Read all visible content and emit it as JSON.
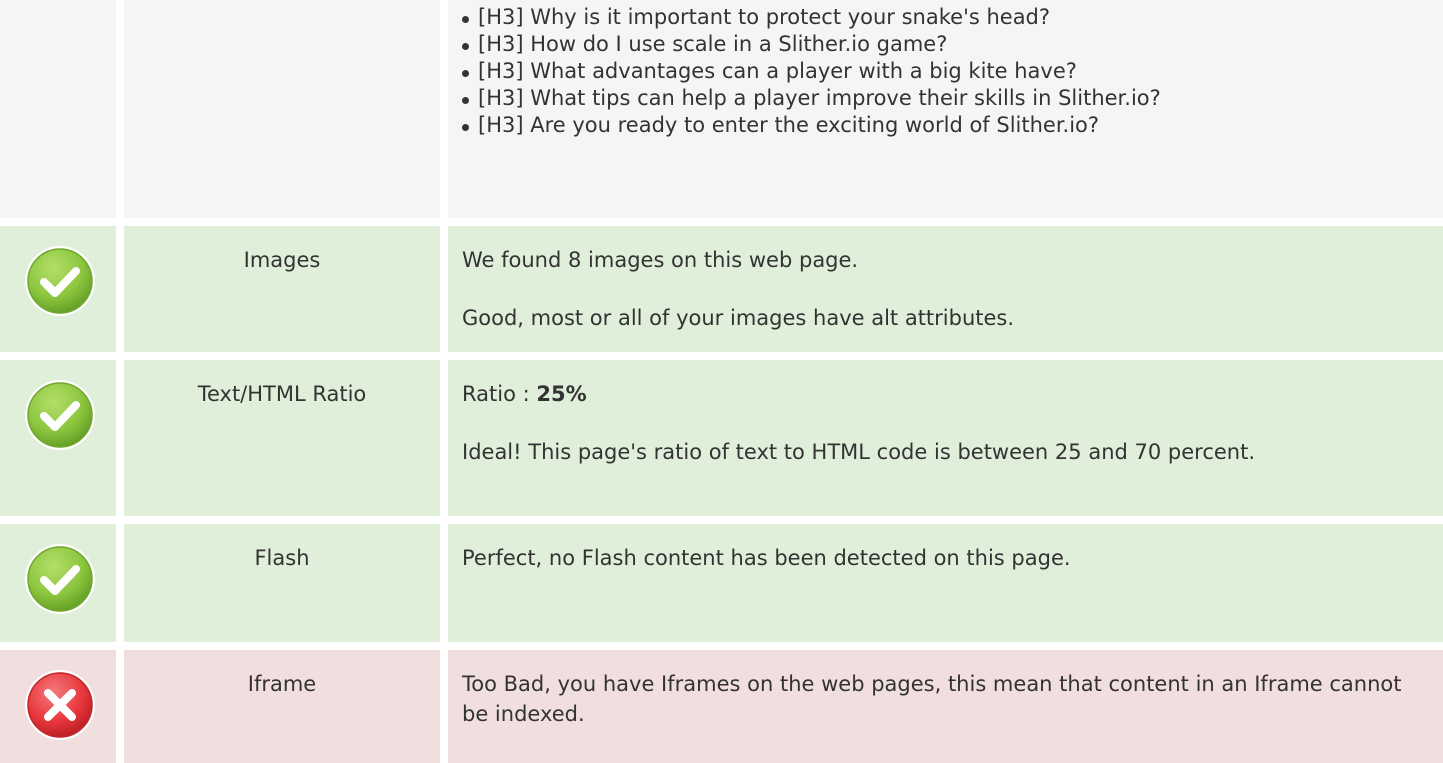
{
  "headings_list": {
    "items": [
      "[H3] Why is it important to protect your snake's head?",
      "[H3] How do I use scale in a Slither.io game?",
      "[H3] What advantages can a player with a big kite have?",
      "[H3] What tips can help a player improve their skills in Slither.io?",
      "[H3] Are you ready to enter the exciting world of Slither.io?"
    ]
  },
  "rows": {
    "images": {
      "status": "pass",
      "icon": "check-icon",
      "label": "Images",
      "line1": "We found 8 images on this web page.",
      "line2": "Good, most or all of your images have alt attributes."
    },
    "ratio": {
      "status": "pass",
      "icon": "check-icon",
      "label": "Text/HTML Ratio",
      "prefix": "Ratio : ",
      "value": "25%",
      "line2": "Ideal! This page's ratio of text to HTML code is between 25 and 70 percent."
    },
    "flash": {
      "status": "pass",
      "icon": "check-icon",
      "label": "Flash",
      "line1": "Perfect, no Flash content has been detected on this page."
    },
    "iframe": {
      "status": "fail",
      "icon": "cross-icon",
      "label": "Iframe",
      "line1": "Too Bad, you have Iframes on the web pages, this mean that content in an Iframe cannot be indexed."
    }
  },
  "colors": {
    "pass_bg": "#e0efd9",
    "fail_bg": "#f1dedf",
    "neutral_bg": "#f5f5f5",
    "pass_icon": "#8cc63e",
    "fail_icon": "#e8383d"
  }
}
